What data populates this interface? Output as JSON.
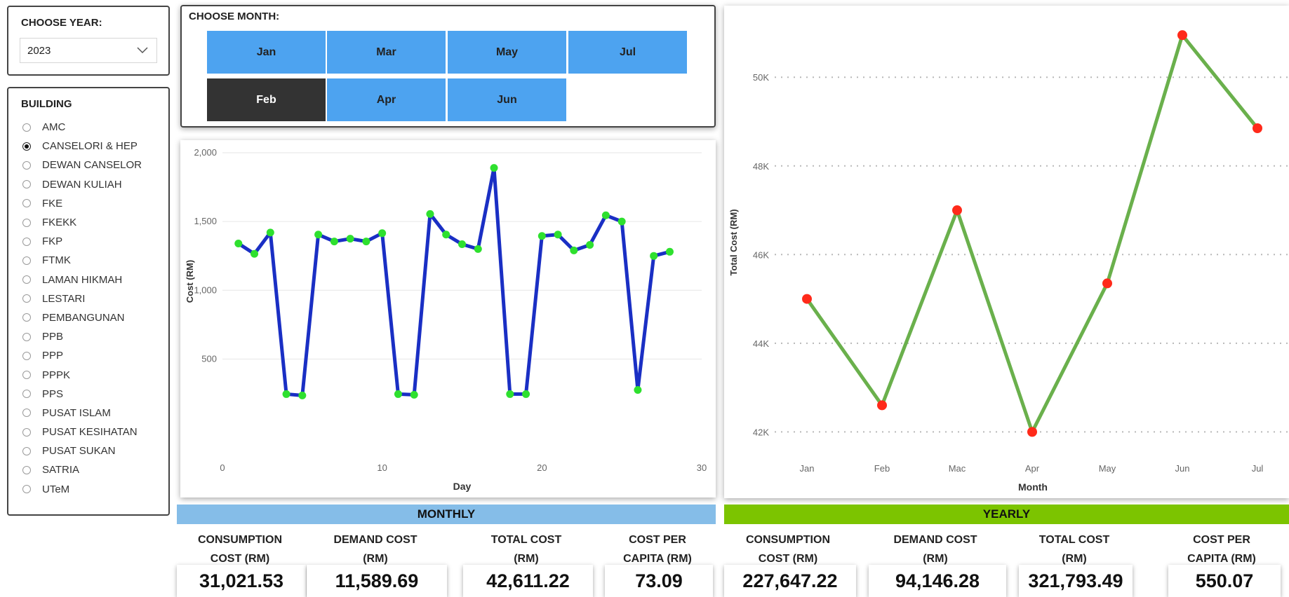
{
  "year_slicer": {
    "title": "CHOOSE YEAR:",
    "selected": "2023",
    "icon": "chevron-down-icon"
  },
  "building_slicer": {
    "title": "BUILDING",
    "items": [
      "AMC",
      "CANSELORI & HEP",
      "DEWAN CANSELOR",
      "DEWAN KULIAH",
      "FKE",
      "FKEKK",
      "FKP",
      "FTMK",
      "LAMAN HIKMAH",
      "LESTARI",
      "PEMBANGUNAN",
      "PPB",
      "PPP",
      "PPPK",
      "PPS",
      "PUSAT ISLAM",
      "PUSAT KESIHATAN",
      "PUSAT SUKAN",
      "SATRIA",
      "UTeM"
    ],
    "selected": "CANSELORI & HEP"
  },
  "month_slicer": {
    "title": "CHOOSE MONTH:",
    "months": [
      "Jan",
      "Feb",
      "Mar",
      "Apr",
      "May",
      "Jun",
      "Jul"
    ],
    "selected": "Feb",
    "colors": {
      "button": "#4da3f0",
      "selected": "#333333"
    }
  },
  "chart_data": [
    {
      "type": "line",
      "xlabel": "Day",
      "ylabel": "Cost (RM)",
      "x_ticks": [
        0,
        10,
        20,
        30
      ],
      "y_ticks": [
        500,
        1000,
        1500,
        2000
      ],
      "y_tick_labels": [
        "500",
        "1,000",
        "1,500",
        "2,000"
      ],
      "xlim": [
        0,
        30
      ],
      "ylim": [
        130,
        2000
      ],
      "grid": true,
      "line_color": "#1a2fc4",
      "marker_color": "#2ee02e",
      "x": [
        1,
        2,
        3,
        4,
        5,
        6,
        7,
        8,
        9,
        10,
        11,
        12,
        13,
        14,
        15,
        16,
        17,
        18,
        19,
        20,
        21,
        22,
        23,
        24,
        25,
        26,
        27,
        28
      ],
      "y": [
        1340,
        1265,
        1420,
        245,
        235,
        1405,
        1355,
        1375,
        1355,
        1415,
        245,
        240,
        1555,
        1405,
        1335,
        1300,
        1890,
        245,
        245,
        1395,
        1405,
        1290,
        1330,
        1545,
        1500,
        275,
        1250,
        1280
      ]
    },
    {
      "type": "line",
      "xlabel": "Month",
      "ylabel": "Total Cost (RM)",
      "categories": [
        "Jan",
        "Feb",
        "Mac",
        "Apr",
        "May",
        "Jun",
        "Jul"
      ],
      "y_ticks": [
        42000,
        44000,
        46000,
        48000,
        50000
      ],
      "y_tick_labels": [
        "42K",
        "44K",
        "46K",
        "48K",
        "50K"
      ],
      "ylim": [
        41500,
        51300
      ],
      "grid": true,
      "line_color": "#6ab04c",
      "marker_color": "#ff2a1a",
      "values": [
        45000,
        42600,
        47000,
        42000,
        45350,
        50950,
        48850
      ]
    }
  ],
  "summary": {
    "monthly": {
      "title": "MONTHLY",
      "color": "#85bde8",
      "kpis": [
        {
          "label_l1": "CONSUMPTION",
          "label_l2": "COST (RM)",
          "value": "31,021.53"
        },
        {
          "label_l1": "DEMAND COST",
          "label_l2": "(RM)",
          "value": "11,589.69"
        },
        {
          "label_l1": "TOTAL COST",
          "label_l2": "(RM)",
          "value": "42,611.22"
        },
        {
          "label_l1": "COST PER",
          "label_l2": "CAPITA (RM)",
          "value": "73.09"
        }
      ]
    },
    "yearly": {
      "title": "YEARLY",
      "color": "#7cc400",
      "kpis": [
        {
          "label_l1": "CONSUMPTION",
          "label_l2": "COST (RM)",
          "value": "227,647.22"
        },
        {
          "label_l1": "DEMAND COST",
          "label_l2": "(RM)",
          "value": "94,146.28"
        },
        {
          "label_l1": "TOTAL COST",
          "label_l2": "(RM)",
          "value": "321,793.49"
        },
        {
          "label_l1": "COST PER",
          "label_l2": "CAPITA (RM)",
          "value": "550.07"
        }
      ]
    }
  }
}
